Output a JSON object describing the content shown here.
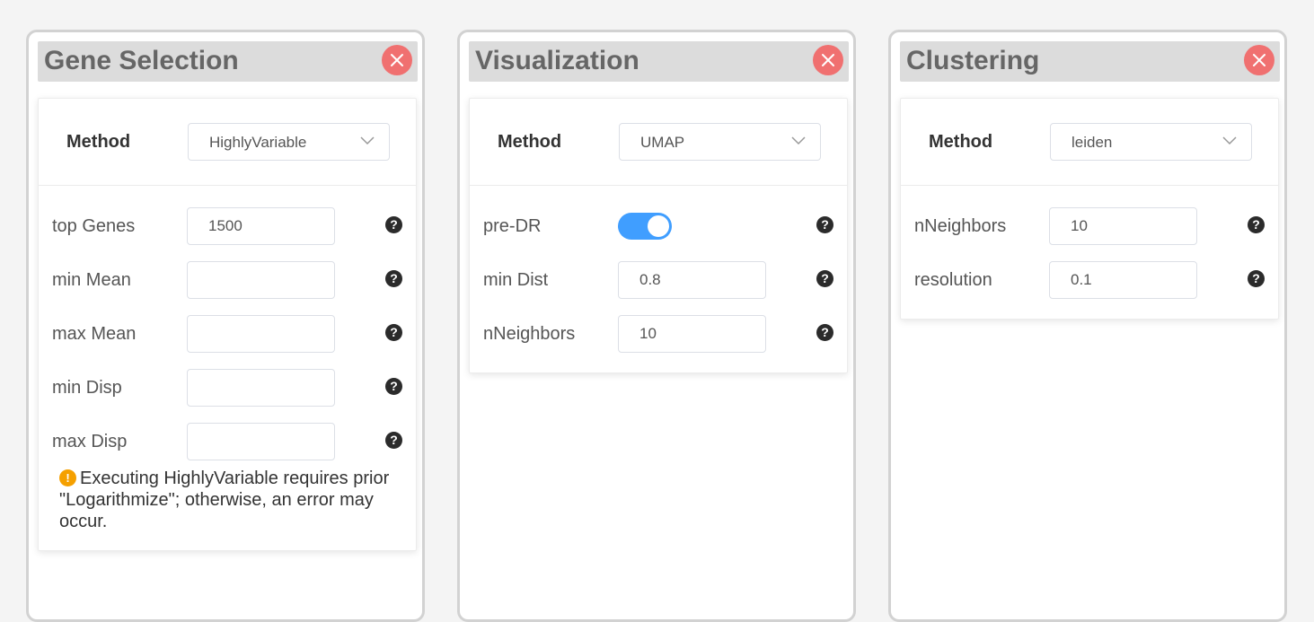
{
  "panels": [
    {
      "title": "Gene Selection",
      "method": {
        "label": "Method",
        "value": "HighlyVariable"
      },
      "params": [
        {
          "label": "top Genes",
          "type": "input",
          "value": "1500"
        },
        {
          "label": "min Mean",
          "type": "input",
          "value": ""
        },
        {
          "label": "max Mean",
          "type": "input",
          "value": ""
        },
        {
          "label": "min Disp",
          "type": "input",
          "value": ""
        },
        {
          "label": "max Disp",
          "type": "input",
          "value": ""
        }
      ],
      "warning": "Executing HighlyVariable requires prior \"Logarithmize\"; otherwise, an error may occur."
    },
    {
      "title": "Visualization",
      "method": {
        "label": "Method",
        "value": "UMAP"
      },
      "params": [
        {
          "label": "pre-DR",
          "type": "toggle",
          "value": true
        },
        {
          "label": "min Dist",
          "type": "input",
          "value": "0.8"
        },
        {
          "label": "nNeighbors",
          "type": "input",
          "value": "10"
        }
      ]
    },
    {
      "title": "Clustering",
      "method": {
        "label": "Method",
        "value": "leiden"
      },
      "params": [
        {
          "label": "nNeighbors",
          "type": "input",
          "value": "10"
        },
        {
          "label": "resolution",
          "type": "input",
          "value": "0.1"
        }
      ]
    }
  ],
  "icons": {
    "help": "?",
    "warning": "!"
  },
  "colors": {
    "close_button": "#f07070",
    "toggle_on": "#409eff",
    "warning_icon": "#f5a000",
    "help_icon": "#2b2b2b"
  }
}
